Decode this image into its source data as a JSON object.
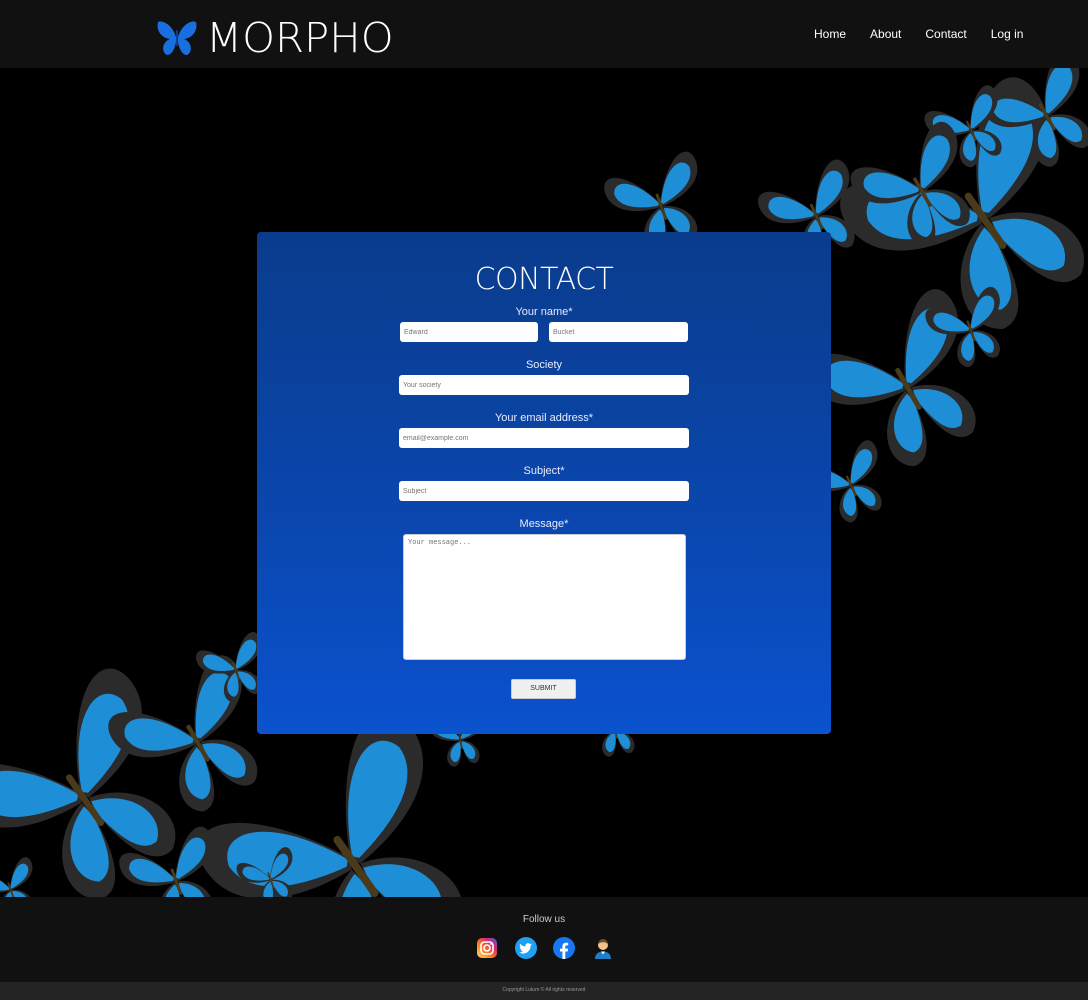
{
  "brand": {
    "name": "MORPHO"
  },
  "nav": {
    "items": [
      "Home",
      "About",
      "Contact",
      "Log in"
    ]
  },
  "contact": {
    "title": "CONTACT",
    "name_label": "Your name*",
    "first_name_placeholder": "Edward",
    "last_name_placeholder": "Bucket",
    "society_label": "Society",
    "society_placeholder": "Your society",
    "email_label": "Your email address*",
    "email_placeholder": "email@example.com",
    "subject_label": "Subject*",
    "subject_placeholder": "Subject",
    "message_label": "Message*",
    "message_placeholder": "Your message...",
    "submit_label": "SUBMIT"
  },
  "footer": {
    "follow_label": "Follow us",
    "socials": [
      "instagram-icon",
      "twitter-icon",
      "facebook-icon",
      "profile-icon"
    ],
    "copyright": "Copyright Lutum © All rights reserved"
  },
  "colors": {
    "header_bg": "#111111",
    "panel_top": "#0a3c8c",
    "panel_bottom": "#0b52cf",
    "butterfly_blue": "#1e8fd6",
    "butterfly_dark": "#2b2b2b",
    "logo_blue": "#1a6fe0"
  }
}
